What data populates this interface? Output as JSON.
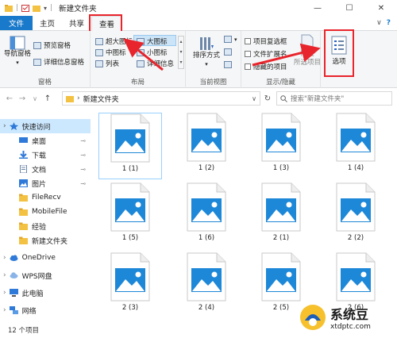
{
  "window": {
    "title": "新建文件夹",
    "minimize": "—",
    "maximize": "☐",
    "close": "✕"
  },
  "tabs": [
    {
      "label": "文件"
    },
    {
      "label": "主页"
    },
    {
      "label": "共享"
    },
    {
      "label": "查看"
    }
  ],
  "ribbon": {
    "panes": {
      "nav_pane": "导航窗格",
      "preview_pane": "预览窗格",
      "details_pane": "详细信息窗格",
      "group_label": "窗格"
    },
    "layout": {
      "extra_large": "超大图标",
      "large": "大图标",
      "medium": "中图标",
      "small": "小图标",
      "list": "列表",
      "details": "详细信息",
      "group_label": "布局"
    },
    "current_view": {
      "sort": "排序方式",
      "group_label": "当前视图"
    },
    "show_hide": {
      "item_checkbox": "项目复选框",
      "file_ext": "文件扩展名",
      "hidden_items": "隐藏的项目",
      "hide": "隐藏",
      "selected_items": "所选项目",
      "group_label": "显示/隐藏"
    },
    "options": "选项"
  },
  "address": {
    "path": "新建文件夹",
    "search_placeholder": "搜索\"新建文件夹\""
  },
  "nav": [
    {
      "label": "快速访问",
      "icon": "star-icon",
      "pinned": false,
      "selected": true
    },
    {
      "label": "桌面",
      "icon": "desktop-icon",
      "pinned": true
    },
    {
      "label": "下载",
      "icon": "download-icon",
      "pinned": true
    },
    {
      "label": "文档",
      "icon": "document-icon",
      "pinned": true
    },
    {
      "label": "图片",
      "icon": "pictures-icon",
      "pinned": true
    },
    {
      "label": "FileRecv",
      "icon": "folder-icon"
    },
    {
      "label": "MobileFile",
      "icon": "folder-icon"
    },
    {
      "label": "经验",
      "icon": "folder-icon"
    },
    {
      "label": "新建文件夹",
      "icon": "folder-icon"
    },
    {
      "label": "OneDrive",
      "icon": "cloud-icon"
    },
    {
      "label": "WPS网盘",
      "icon": "wps-cloud-icon"
    },
    {
      "label": "此电脑",
      "icon": "computer-icon"
    },
    {
      "label": "网络",
      "icon": "network-icon"
    }
  ],
  "files": [
    {
      "name": "1 (1)"
    },
    {
      "name": "1 (2)"
    },
    {
      "name": "1 (3)"
    },
    {
      "name": "1 (4)"
    },
    {
      "name": "1 (5)"
    },
    {
      "name": "1 (6)"
    },
    {
      "name": "2 (1)"
    },
    {
      "name": "2 (2)"
    },
    {
      "name": "2 (3)"
    },
    {
      "name": "2 (4)"
    },
    {
      "name": "2 (5)"
    },
    {
      "name": "2 (6)"
    }
  ],
  "status": {
    "count": "12 个项目"
  },
  "watermark": {
    "cn": "系统豆",
    "url": "xtdptc.com"
  },
  "colors": {
    "file_tab": "#1979ca",
    "highlight": "#e8242c",
    "selection": "#cce8ff",
    "image_icon": "#1e88d8"
  }
}
